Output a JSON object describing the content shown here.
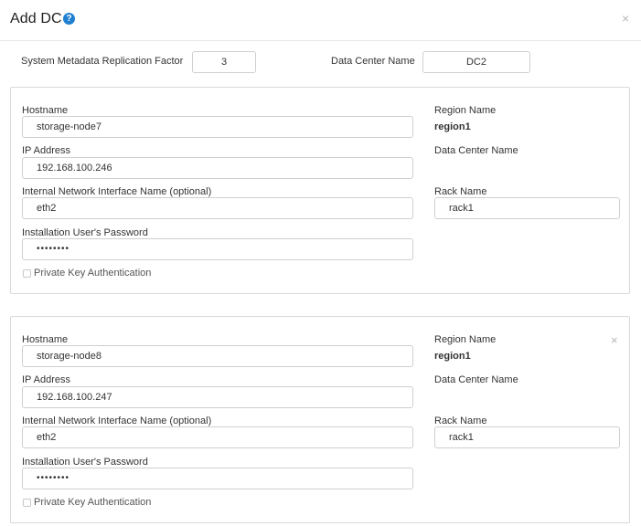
{
  "dialog": {
    "title": "Add DC",
    "help_icon": "question-icon",
    "help_glyph": "?",
    "close_glyph": "×"
  },
  "top_fields": {
    "replication_label": "System Metadata Replication Factor",
    "replication_value": "3",
    "dc_name_label": "Data Center Name",
    "dc_name_value": "DC2"
  },
  "nodes": [
    {
      "hostname_label": "Hostname",
      "hostname": "storage-node7",
      "ip_label": "IP Address",
      "ip": "192.168.100.246",
      "iface_label": "Internal Network Interface Name (optional)",
      "iface": "eth2",
      "password_label": "Installation User's Password",
      "password": "••••••••",
      "private_key_label": "Private Key Authentication",
      "region_label": "Region Name",
      "region": "region1",
      "dc_label": "Data Center Name",
      "rack_label": "Rack Name",
      "rack": "rack1"
    },
    {
      "hostname_label": "Hostname",
      "hostname": "storage-node8",
      "ip_label": "IP Address",
      "ip": "192.168.100.247",
      "iface_label": "Internal Network Interface Name (optional)",
      "iface": "eth2",
      "password_label": "Installation User's Password",
      "password": "••••••••",
      "private_key_label": "Private Key Authentication",
      "region_label": "Region Name",
      "region": "region1",
      "dc_label": "Data Center Name",
      "rack_label": "Rack Name",
      "rack": "rack1",
      "remove_glyph": "×"
    }
  ]
}
